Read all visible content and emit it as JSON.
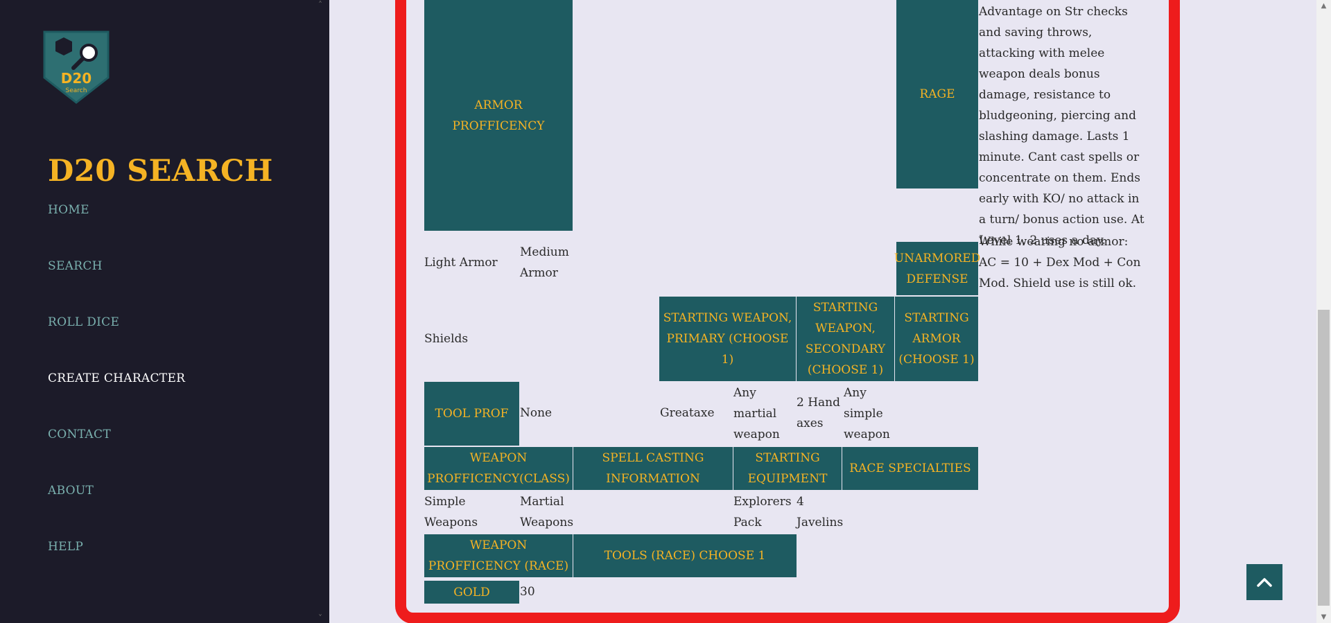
{
  "sidebar": {
    "logo_text": "D20",
    "logo_subtext": "Search",
    "title": "D20 SEARCH",
    "nav": [
      {
        "label": "HOME"
      },
      {
        "label": "SEARCH"
      },
      {
        "label": "ROLL DICE"
      },
      {
        "label": "CREATE CHARACTER"
      },
      {
        "label": "CONTACT"
      },
      {
        "label": "ABOUT"
      },
      {
        "label": "HELP"
      }
    ],
    "active_item": "CREATE CHARACTER"
  },
  "table": {
    "armor_proficiency_header": "ARMOR PROFFICENCY",
    "armor_items": [
      "Light Armor",
      "Medium Armor",
      "Shields"
    ],
    "rage_header": "RAGE",
    "rage_text": "Advantage on Str checks and saving throws, attacking with melee weapon deals bonus damage, resistance to bludgeoning, piercing and slashing damage. Lasts 1 minute. Cant cast spells or concentrate on them. Ends early with KO/ no attack in a turn/ bonus action use. At Level 1, 2 uses a day.",
    "unarmored_header": "UNARMORED DEFENSE",
    "unarmored_text": "While wearing no armor: AC = 10 + Dex Mod + Con Mod. Shield use is still ok.",
    "starting_weapon_primary_header": "STARTING WEAPON, PRIMARY (CHOOSE 1)",
    "starting_weapon_secondary_header": "STARTING WEAPON, SECONDARY (CHOOSE 1)",
    "starting_armor_header": "STARTING ARMOR (CHOOSE 1)",
    "tool_prof_header": "TOOL PROF",
    "tool_prof_value": "None",
    "primary_weapons": [
      "Greataxe",
      "Any martial weapon"
    ],
    "secondary_weapons": [
      "2 Hand axes",
      "Any simple weapon"
    ],
    "weapon_prof_class_header": "WEAPON PROFFICENCY(CLASS)",
    "spell_casting_header": "SPELL CASTING INFORMATION",
    "starting_equipment_header": "STARTING EQUIPMENT",
    "race_specialties_header": "RACE SPECIALTIES",
    "weapon_prof_class_values": [
      "Simple Weapons",
      "Martial Weapons"
    ],
    "starting_equipment_values": [
      "Explorers Pack",
      "4 Javelins"
    ],
    "weapon_prof_race_header": "WEAPON PROFFICENCY (RACE)",
    "tools_race_header": "TOOLS (RACE) CHOOSE 1",
    "gold_header": "GOLD",
    "gold_value": "30"
  },
  "colors": {
    "accent": "#f5b324",
    "header_bg": "#1e5b61",
    "sidebar_bg": "#1c1b29",
    "card_border": "#ee1c1c"
  },
  "icons": {
    "back_to_top": "chevron-up-icon"
  }
}
